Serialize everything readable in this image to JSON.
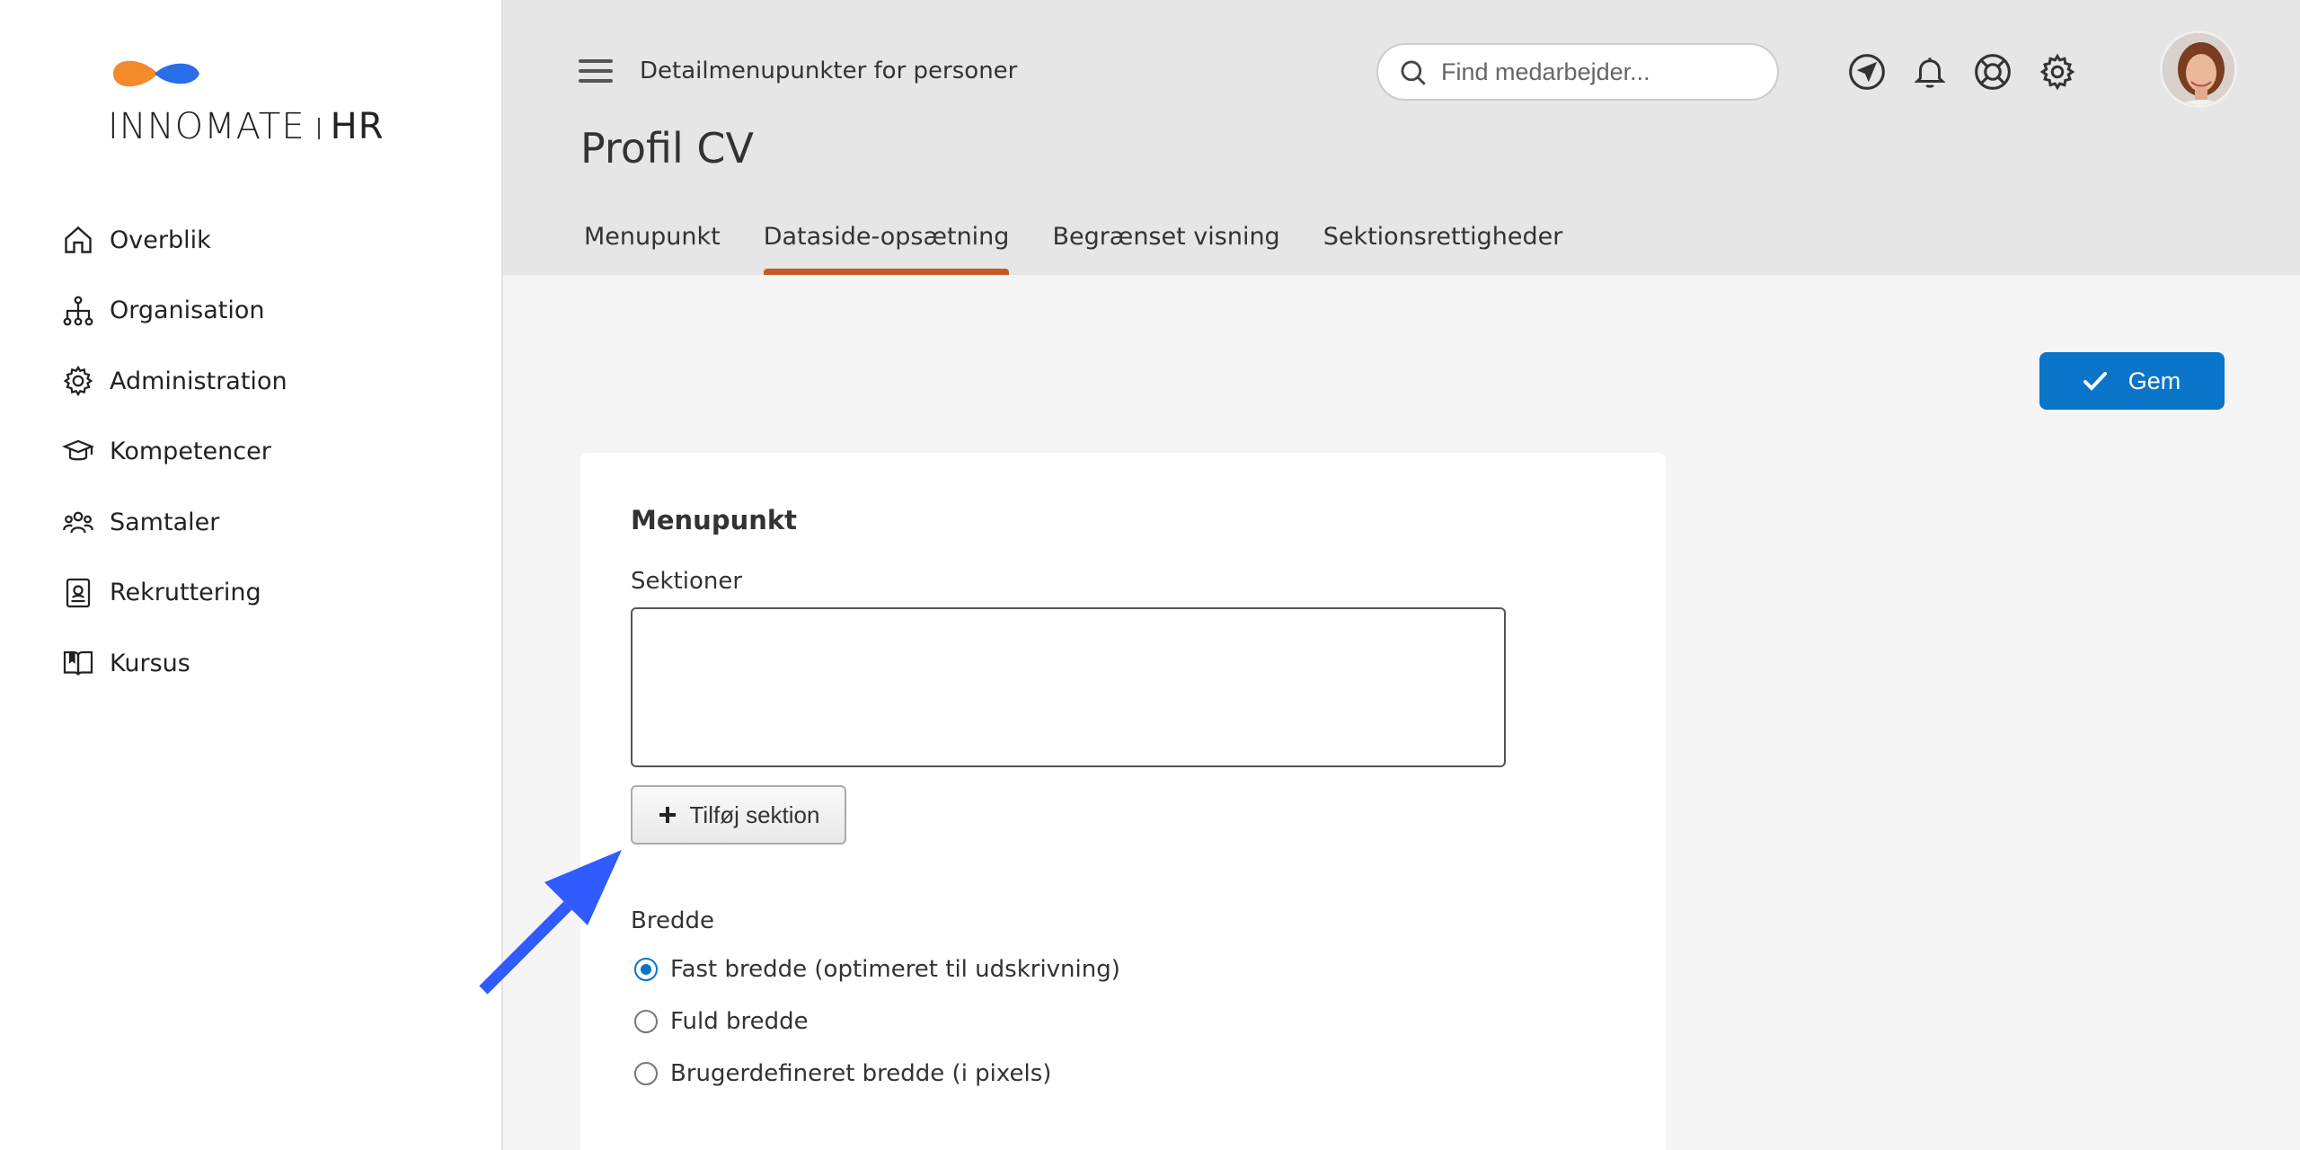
{
  "brand": {
    "name_light": "INNOMATE",
    "name_bold": "HR"
  },
  "sidebar": {
    "items": [
      {
        "label": "Overblik",
        "icon": "home-icon"
      },
      {
        "label": "Organisation",
        "icon": "org-chart-icon"
      },
      {
        "label": "Administration",
        "icon": "gear-icon"
      },
      {
        "label": "Kompetencer",
        "icon": "graduation-cap-icon"
      },
      {
        "label": "Samtaler",
        "icon": "people-icon"
      },
      {
        "label": "Rekruttering",
        "icon": "badge-icon"
      },
      {
        "label": "Kursus",
        "icon": "book-icon"
      }
    ]
  },
  "header": {
    "breadcrumb": "Detailmenupunkter for personer",
    "title": "Profil CV",
    "search_placeholder": "Find medarbejder...",
    "tabs": [
      {
        "label": "Menupunkt",
        "active": false
      },
      {
        "label": "Dataside-opsætning",
        "active": true
      },
      {
        "label": "Begrænset visning",
        "active": false
      },
      {
        "label": "Sektionsrettigheder",
        "active": false
      }
    ]
  },
  "toolbar": {
    "save_label": "Gem"
  },
  "card": {
    "title": "Menupunkt",
    "sections_label": "Sektioner",
    "add_section_label": "Tilføj sektion",
    "width_label": "Bredde",
    "width_options": [
      {
        "label": "Fast bredde (optimeret til udskrivning)",
        "selected": true
      },
      {
        "label": "Fuld bredde",
        "selected": false
      },
      {
        "label": "Brugerdefineret bredde (i pixels)",
        "selected": false
      }
    ]
  },
  "colors": {
    "accent": "#0a74c8",
    "tab_underline": "#c65a22",
    "annotation_arrow": "#2f5bff",
    "logo_orange": "#f58a2a",
    "logo_blue": "#2a6de8"
  }
}
